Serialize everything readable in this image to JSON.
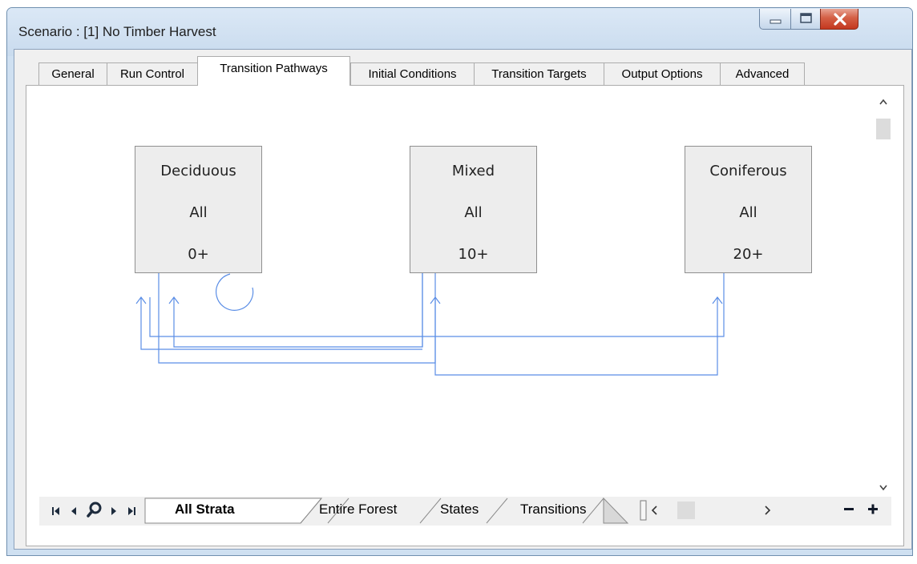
{
  "window": {
    "title": "Scenario : [1] No Timber Harvest",
    "accent_color": "#3a78e0"
  },
  "tabs": [
    {
      "label": "General"
    },
    {
      "label": "Run Control"
    },
    {
      "label": "Transition Pathways",
      "active": true
    },
    {
      "label": "Initial Conditions"
    },
    {
      "label": "Transition Targets"
    },
    {
      "label": "Output Options"
    },
    {
      "label": "Advanced"
    }
  ],
  "diagram": {
    "states": [
      {
        "name": "Deciduous",
        "strata": "All",
        "age": "0+"
      },
      {
        "name": "Mixed",
        "strata": "All",
        "age": "10+"
      },
      {
        "name": "Coniferous",
        "strata": "All",
        "age": "20+"
      }
    ],
    "arrow_color": "#5b8ee6"
  },
  "bottom_tabs": [
    {
      "label": "All Strata",
      "active": true
    },
    {
      "label": "Entire Forest"
    },
    {
      "label": "States"
    },
    {
      "label": "Transitions"
    }
  ],
  "icons": {
    "nav_first": "first-record-icon",
    "nav_prev": "previous-record-icon",
    "search": "search-icon",
    "nav_next": "next-record-icon",
    "nav_last": "last-record-icon",
    "zoom_out": "minus",
    "zoom_in": "plus"
  }
}
